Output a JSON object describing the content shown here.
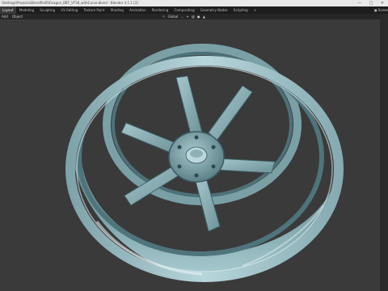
{
  "window": {
    "title": "\\Settings\\Projects\\BlendProfil\\Fisagon_BBT_VF58_withCurve.blend - Blender 4.1.1 [3]",
    "minimize_icon": "minimize-icon",
    "maximize_icon": "maximize-icon",
    "close_icon": "close-icon"
  },
  "workspace_tabs": [
    {
      "label": "Layout",
      "active": true
    },
    {
      "label": "Modeling"
    },
    {
      "label": "Sculpting"
    },
    {
      "label": "UV Editing"
    },
    {
      "label": "Texture Paint"
    },
    {
      "label": "Shading"
    },
    {
      "label": "Animation"
    },
    {
      "label": "Rendering"
    },
    {
      "label": "Compositing"
    },
    {
      "label": "Geometry Nodes"
    },
    {
      "label": "Scripting"
    },
    {
      "label": "+"
    }
  ],
  "scene_label": "Scene",
  "header": {
    "menus": [
      "Add",
      "Object"
    ],
    "orientation": "Global"
  },
  "colors": {
    "viewport_bg": "#3a3a3a",
    "wheel_base": "#86aab0",
    "wheel_shadow": "#2f4b52",
    "wheel_highlight": "#eef6f7"
  }
}
